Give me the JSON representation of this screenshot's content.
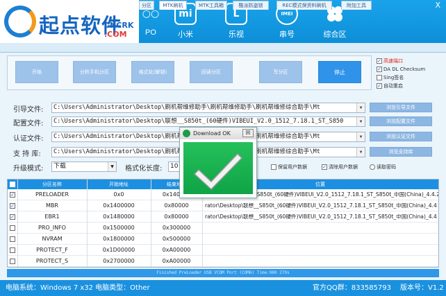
{
  "header": {
    "logo_text": "起点软件",
    "logo_sub1": "CNCRK",
    "logo_sub2": ".COM",
    "close": "X",
    "nav": [
      {
        "label": "PO",
        "glyph": ""
      },
      {
        "label": "小米",
        "glyph": "mi"
      },
      {
        "label": "乐视",
        "glyph": "L"
      },
      {
        "label": "串号",
        "glyph": "IMEI"
      },
      {
        "label": "综合区",
        "glyph": ""
      }
    ]
  },
  "tabs": [
    "分区",
    "MTK刷机",
    "MTK工具箱",
    "酷派防盗锁",
    "REC模式保资料刷机",
    "附加工具"
  ],
  "actions": {
    "buttons": [
      "开始",
      "分析手机分区",
      "格式化(解锁)",
      "回读分区",
      "写分区"
    ],
    "stop": "停止"
  },
  "options": [
    {
      "label": "高速端口",
      "checked": true,
      "red": true
    },
    {
      "label": "DA DL Checksum",
      "checked": true,
      "red": false
    },
    {
      "label": "Sing签名",
      "checked": false,
      "red": false
    },
    {
      "label": "自动重启",
      "checked": true,
      "red": false
    }
  ],
  "rows": {
    "labels": [
      "引导文件:",
      "配置文件:",
      "认证文件:",
      "支 持 库:"
    ],
    "paths": [
      "C:\\Users\\Administrator\\Desktop\\刷机帮维修助手\\刷机帮维修助手\\刷机帮维修综合助手\\Mt",
      "C:\\Users\\Administrator\\Desktop\\联想__S850t_(60硬件)VIBEUI_V2.0_1512_7.18.1_ST_S850",
      "C:\\Users\\Administrator\\Desktop\\刷机帮维修助手\\刷机帮维修助手\\刷机帮维修综合助手\\Mt",
      "C:\\Users\\Administrator\\Desktop\\刷机帮维修助手\\刷机帮维修助手\\刷机帮维修综合助手\\Mt"
    ],
    "buttons": [
      "浏览引导文件",
      "浏览配置文件",
      "浏览认证文件",
      "浏览支持库"
    ],
    "mode_label": "升级模式:",
    "mode_value": "下载",
    "format_label": "格式化长度:",
    "format_value": "10",
    "keep_user": "保留用户数据",
    "clear_user": "清除用户数据",
    "read_password": "读取密码"
  },
  "table": {
    "headers": [
      "分区名称",
      "开始地址",
      "结束地址",
      "位置"
    ],
    "rows": [
      {
        "checked": true,
        "name": "PRELOADER",
        "start": "0x0",
        "end": "0x140000",
        "pos": "ator\\Desktop\\联想__S850t_(60硬件)VIBEUI_V2.0_1512_7.18.1_ST_S850t_中国(China)_4.4.2(1)刷机"
      },
      {
        "checked": true,
        "name": "MBR",
        "start": "0x1400000",
        "end": "0x80000",
        "pos": "rator\\Desktop\\联想__S850t_(60硬件)VIBEUI_V2.0_1512_7.18.1_ST_S850t_中国(China)_4.4"
      },
      {
        "checked": true,
        "name": "EBR1",
        "start": "0x1480000",
        "end": "0x80000",
        "pos": "rator\\Desktop\\联想__S850t_(60硬件)VIBEUI_V2.0_1512_7.18.1_ST_S850t_中国(China)_4.4"
      },
      {
        "checked": false,
        "name": "PRO_INFO",
        "start": "0x1500000",
        "end": "0x300000",
        "pos": ""
      },
      {
        "checked": false,
        "name": "NVRAM",
        "start": "0x1800000",
        "end": "0x500000",
        "pos": ""
      },
      {
        "checked": false,
        "name": "PROTECT_F",
        "start": "0x1D00000",
        "end": "0xA00000",
        "pos": ""
      },
      {
        "checked": false,
        "name": "PROTECT_S",
        "start": "0x2700000",
        "end": "0xA00000",
        "pos": ""
      }
    ]
  },
  "status_strip": "Finished PreLoader USB VCOM Port (COM6) Time:980 279s",
  "footer": {
    "system": "电脑系统：Windows 7 x32  电脑类型：Other",
    "qq": "官方QQ群：833585793",
    "version": "版本号：V1.2"
  },
  "dialog": {
    "title": "Download OK",
    "close": "☒"
  },
  "colors": {
    "header": "#1aa3ea",
    "accent": "#1d8fe0",
    "ok_green": "#1aaf4e"
  }
}
